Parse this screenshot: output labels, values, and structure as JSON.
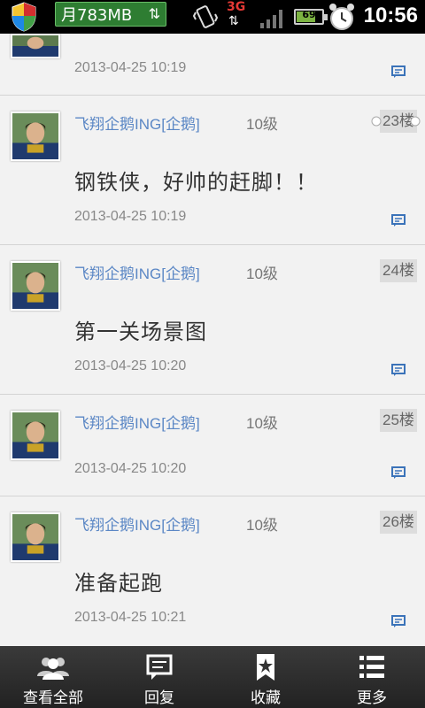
{
  "status_bar": {
    "data_usage": "月783MB",
    "network_type": "3G",
    "battery_level": "69",
    "battery_fraction": 0.69,
    "time": "10:56"
  },
  "posts": [
    {
      "author": "",
      "level": "",
      "floor": "",
      "content": "",
      "timestamp": "2013-04-25 10:19"
    },
    {
      "author": "飞翔企鹅ING[企鹅]",
      "level": "10级",
      "floor": "23楼",
      "content": "钢铁侠，好帅的赶脚！！",
      "timestamp": "2013-04-25 10:19"
    },
    {
      "author": "飞翔企鹅ING[企鹅]",
      "level": "10级",
      "floor": "24楼",
      "content": "第一关场景图",
      "timestamp": "2013-04-25 10:20"
    },
    {
      "author": "飞翔企鹅ING[企鹅]",
      "level": "10级",
      "floor": "25楼",
      "content": "",
      "timestamp": "2013-04-25 10:20"
    },
    {
      "author": "飞翔企鹅ING[企鹅]",
      "level": "10级",
      "floor": "26楼",
      "content": "准备起跑",
      "timestamp": "2013-04-25 10:21"
    }
  ],
  "toolbar": {
    "view_all": "查看全部",
    "reply": "回复",
    "favorite": "收藏",
    "more": "更多"
  },
  "icons": {
    "view_all": "people-icon",
    "reply": "comment-icon",
    "favorite": "bookmark-star-icon",
    "more": "list-menu-icon"
  }
}
